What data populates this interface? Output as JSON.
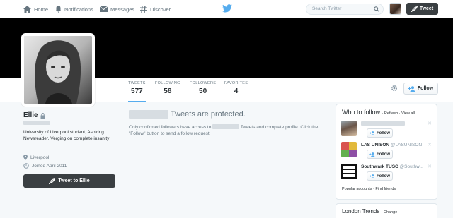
{
  "nav": {
    "home": "Home",
    "notifications": "Notifications",
    "messages": "Messages",
    "discover": "Discover",
    "search_placeholder": "Search Twitter",
    "tweet_button": "Tweet"
  },
  "profile": {
    "name": "Ellie",
    "bio": "University of Liverpool student, Aspiring Newsreader, Verging on complete insanity",
    "location": "Liverpool",
    "joined": "Joined April 2011",
    "tweet_to_button": "Tweet to Ellie",
    "follow_button": "Follow"
  },
  "stats": [
    {
      "label": "TWEETS",
      "value": "577"
    },
    {
      "label": "FOLLOWING",
      "value": "58"
    },
    {
      "label": "FOLLOWERS",
      "value": "50"
    },
    {
      "label": "FAVORITES",
      "value": "4"
    }
  ],
  "protected": {
    "title": "Tweets are protected.",
    "text_before": "Only confirmed followers have access to",
    "text_after": "Tweets and complete profile. Click the \"Follow\" button to send a follow request."
  },
  "who_to_follow": {
    "title": "Who to follow",
    "refresh": "Refresh",
    "view_all": "View all",
    "suggestions": [
      {
        "name": "",
        "screen_name": "",
        "follow": "Follow"
      },
      {
        "name": "LAS UNISON",
        "screen_name": "@LASUNISON",
        "follow": "Follow"
      },
      {
        "name": "Southwark TUSC",
        "screen_name": "@Southw...",
        "follow": "Follow"
      }
    ],
    "footer": "Popular accounts · Find friends"
  },
  "trends": {
    "title": "London Trends",
    "change": "Change"
  },
  "colors": {
    "accent": "#55acee",
    "header_bg": "#000000",
    "dark_button": "#3a3f42"
  }
}
